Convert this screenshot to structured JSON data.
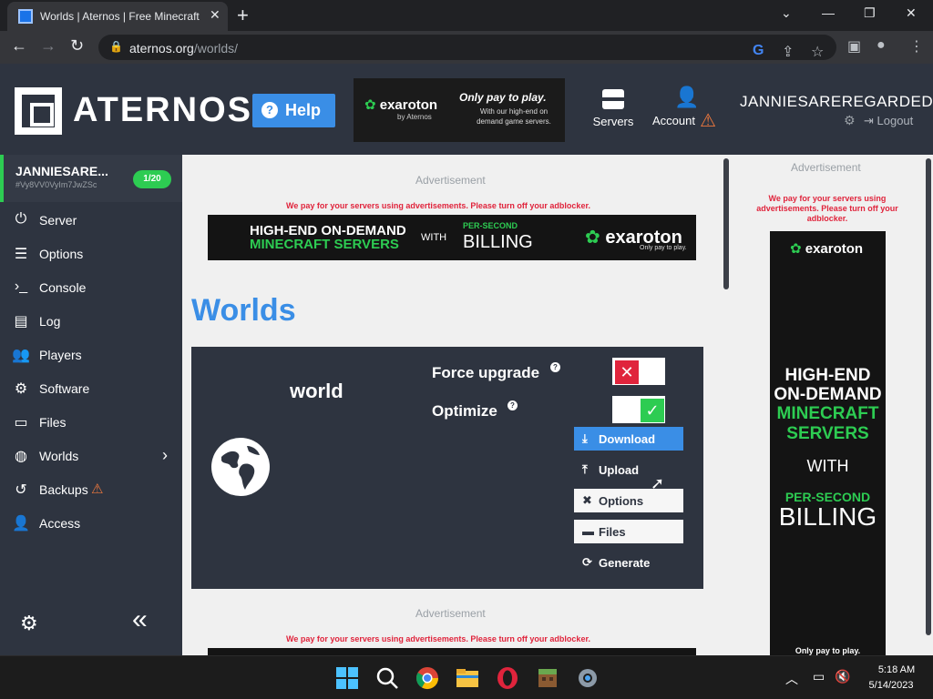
{
  "browser": {
    "tab_title": "Worlds | Aternos | Free Minecraft",
    "tab_close": "✕",
    "new_tab": "+",
    "url_host": "aternos.org",
    "url_path": "/worlds/",
    "window_controls": [
      "⌄",
      "—",
      "❐",
      "✕"
    ]
  },
  "header": {
    "logo_text": "ATERNOS",
    "help_label": "Help",
    "ad": {
      "brand": "exaroton",
      "byline": "by Aternos",
      "headline": "Only pay to play.",
      "subtext": "With our high-end on demand game servers."
    },
    "servers_label": "Servers",
    "account_label": "Account",
    "username": "JANNIESAREREGARDED",
    "logout_label": "Logout"
  },
  "sidebar": {
    "server_name": "JANNIESARE...",
    "server_id": "#Vy8VV0VyIm7JwZSc",
    "players": "1/20",
    "items": [
      {
        "label": "Server",
        "icon": "⏻"
      },
      {
        "label": "Options",
        "icon": "☰"
      },
      {
        "label": "Console",
        "icon": "›_"
      },
      {
        "label": "Log",
        "icon": "▤"
      },
      {
        "label": "Players",
        "icon": "👥"
      },
      {
        "label": "Software",
        "icon": "⚙"
      },
      {
        "label": "Files",
        "icon": "▭"
      },
      {
        "label": "Worlds",
        "icon": "◍"
      },
      {
        "label": "Backups",
        "icon": "↺"
      },
      {
        "label": "Access",
        "icon": "👤"
      }
    ],
    "worlds_chevron": "›",
    "collapse_icon": "«"
  },
  "main": {
    "ad_label": "Advertisement",
    "adblock_warning": "We pay for your servers using advertisements. Please turn off your adblocker.",
    "top_banner": {
      "line1": "HIGH-END ON-DEMAND",
      "line2": "MINECRAFT SERVERS",
      "with": "WITH",
      "per_second": "PER-SECOND",
      "billing": "BILLING",
      "brand": "exaroton",
      "tagline": "Only pay to play."
    },
    "page_title": "Worlds",
    "world": {
      "name": "world",
      "force_upgrade_label": "Force upgrade",
      "optimize_label": "Optimize",
      "help_glyph": "?",
      "force_upgrade_on": false,
      "optimize_on": true,
      "buttons": [
        {
          "label": "Download",
          "icon": "⤓"
        },
        {
          "label": "Upload",
          "icon": "⤒"
        },
        {
          "label": "Options",
          "icon": "✖"
        },
        {
          "label": "Files",
          "icon": "▬"
        },
        {
          "label": "Generate",
          "icon": "⟳"
        }
      ]
    },
    "side_ad": {
      "brand": "exaroton",
      "line1": "HIGH-END",
      "line2": "ON-DEMAND",
      "line3": "MINECRAFT",
      "line4": "SERVERS",
      "with": "WITH",
      "per_second": "PER-SECOND",
      "billing": "BILLING",
      "tagline": "Only pay to play."
    }
  },
  "taskbar": {
    "time": "5:18 AM",
    "date": "5/14/2023"
  },
  "colors": {
    "accent_blue": "#3a8ee6",
    "header_bg": "#2e3440",
    "green": "#2dcc52",
    "red": "#e0243c",
    "warning_orange": "#f0793e"
  }
}
